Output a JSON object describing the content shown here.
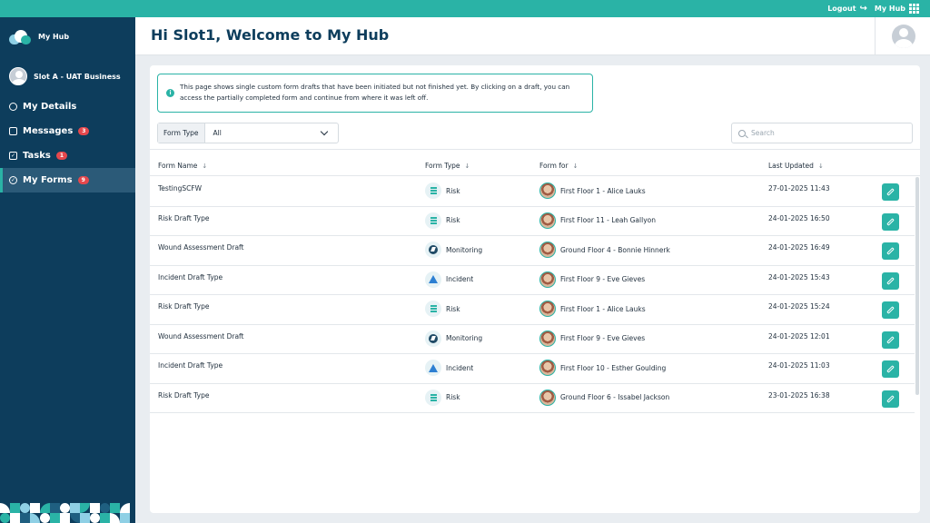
{
  "topbar": {
    "logout_label": "Logout",
    "hub_label": "My Hub"
  },
  "sidebar": {
    "app_name": "My Hub",
    "user_name": "Slot A - UAT Business",
    "items": [
      {
        "label": "My Details",
        "icon": "user-circle-icon"
      },
      {
        "label": "Messages",
        "icon": "envelope-icon",
        "badge": "3"
      },
      {
        "label": "Tasks",
        "icon": "checkbox-icon",
        "badge": "1"
      },
      {
        "label": "My Forms",
        "icon": "form-icon",
        "badge": "9",
        "active": true
      }
    ]
  },
  "header": {
    "title": "Hi Slot1, Welcome to My Hub"
  },
  "info": {
    "text": "This page shows single custom form drafts that have been initiated but not finished yet. By clicking on a draft, you can access the partially completed form and continue from where it was left off."
  },
  "filter": {
    "label": "Form Type",
    "value": "All"
  },
  "search": {
    "placeholder": "Search"
  },
  "table": {
    "headers": {
      "name": "Form Name",
      "type": "Form Type",
      "for": "Form for",
      "updated": "Last Updated"
    },
    "rows": [
      {
        "name": "TestingSCFW",
        "type": "Risk",
        "for": "First Floor 1 - Alice Lauks",
        "updated": "27-01-2025 11:43"
      },
      {
        "name": "Risk Draft Type",
        "type": "Risk",
        "for": "First Floor 11 - Leah Gallyon",
        "updated": "24-01-2025 16:50"
      },
      {
        "name": "Wound Assessment Draft",
        "type": "Monitoring",
        "for": "Ground Floor 4 - Bonnie Hinnerk",
        "updated": "24-01-2025 16:49"
      },
      {
        "name": "Incident Draft Type",
        "type": "Incident",
        "for": "First Floor 9 - Eve Gieves",
        "updated": "24-01-2025 15:43"
      },
      {
        "name": "Risk Draft Type",
        "type": "Risk",
        "for": "First Floor 1 - Alice Lauks",
        "updated": "24-01-2025 15:24"
      },
      {
        "name": "Wound Assessment Draft",
        "type": "Monitoring",
        "for": "First Floor 9 - Eve Gieves",
        "updated": "24-01-2025 12:01"
      },
      {
        "name": "Incident Draft Type",
        "type": "Incident",
        "for": "First Floor 10 - Esther Goulding",
        "updated": "24-01-2025 11:03"
      },
      {
        "name": "Risk Draft Type",
        "type": "Risk",
        "for": "Ground Floor 6 - Issabel Jackson",
        "updated": "23-01-2025 16:38"
      }
    ]
  },
  "colors": {
    "accent": "#2ab3a6",
    "sidebar": "#0d3d5c",
    "badge": "#e5484d",
    "incident": "#2d7fd2"
  }
}
